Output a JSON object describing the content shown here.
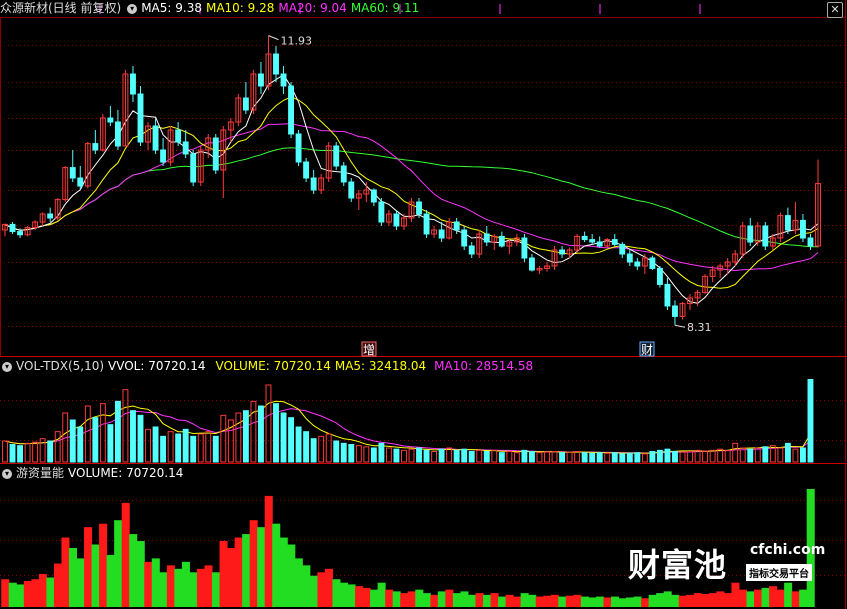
{
  "panel1": {
    "title": "众源新材(日线 前复权)",
    "ma5": "MA5: 9.38",
    "ma10": "MA10: 9.28",
    "ma20": "MA20: 9.04",
    "ma60": "MA60: 9.11",
    "high_label": "11.93",
    "low_label": "8.31",
    "marker1": "增",
    "marker2": "财"
  },
  "panel2": {
    "title": "VOL-TDX(5,10)",
    "vvol": "VVOL: 70720.14",
    "volume": "VOLUME: 70720.14",
    "ma5": "MA5: 32418.04",
    "ma10": "MA10: 28514.58"
  },
  "panel3": {
    "title": "游资量能",
    "volume": "VOLUME: 70720.14"
  },
  "watermark": {
    "main": "财富池",
    "site": "cfchi.com",
    "sub": "指标交易平台"
  },
  "close_icon": "close-icon",
  "colors": {
    "up": "#ff3b3b",
    "down": "#54ffff",
    "ma5": "#ffffff",
    "ma10": "#ffff00",
    "ma20": "#ff33ff",
    "ma60": "#33ff33",
    "red_fill": "#ff1a1a",
    "green_fill": "#22dd22",
    "grid": "#8a0000"
  },
  "chart_data": [
    {
      "type": "candlestick",
      "name": "price",
      "ohlc": [
        [
          9.5,
          9.58,
          9.42,
          9.57
        ],
        [
          9.57,
          9.6,
          9.45,
          9.48
        ],
        [
          9.48,
          9.52,
          9.4,
          9.44
        ],
        [
          9.44,
          9.55,
          9.42,
          9.53
        ],
        [
          9.53,
          9.62,
          9.5,
          9.6
        ],
        [
          9.6,
          9.72,
          9.55,
          9.7
        ],
        [
          9.7,
          9.78,
          9.6,
          9.65
        ],
        [
          9.65,
          9.9,
          9.62,
          9.88
        ],
        [
          9.88,
          10.3,
          9.85,
          10.28
        ],
        [
          10.28,
          10.5,
          10.1,
          10.15
        ],
        [
          10.15,
          10.3,
          10.0,
          10.05
        ],
        [
          10.05,
          10.6,
          10.02,
          10.58
        ],
        [
          10.58,
          10.75,
          10.45,
          10.5
        ],
        [
          10.5,
          10.95,
          10.48,
          10.9
        ],
        [
          10.9,
          11.05,
          10.8,
          10.85
        ],
        [
          10.85,
          11.0,
          10.5,
          10.55
        ],
        [
          10.55,
          11.5,
          10.55,
          11.45
        ],
        [
          11.45,
          11.55,
          11.1,
          11.2
        ],
        [
          11.2,
          11.3,
          10.55,
          10.6
        ],
        [
          10.6,
          10.85,
          10.5,
          10.8
        ],
        [
          10.8,
          10.9,
          10.45,
          10.5
        ],
        [
          10.5,
          10.65,
          10.3,
          10.35
        ],
        [
          10.35,
          10.8,
          10.3,
          10.75
        ],
        [
          10.75,
          10.85,
          10.55,
          10.6
        ],
        [
          10.6,
          10.75,
          10.4,
          10.45
        ],
        [
          10.45,
          10.5,
          10.05,
          10.1
        ],
        [
          10.1,
          10.55,
          10.05,
          10.5
        ],
        [
          10.5,
          10.7,
          10.4,
          10.65
        ],
        [
          10.65,
          10.7,
          10.2,
          10.25
        ],
        [
          10.25,
          10.8,
          9.9,
          10.75
        ],
        [
          10.75,
          10.9,
          10.6,
          10.85
        ],
        [
          10.85,
          11.2,
          10.8,
          11.15
        ],
        [
          11.15,
          11.35,
          10.95,
          11.0
        ],
        [
          11.0,
          11.5,
          10.95,
          11.45
        ],
        [
          11.45,
          11.6,
          11.2,
          11.3
        ],
        [
          11.3,
          11.93,
          11.25,
          11.7
        ],
        [
          11.7,
          11.8,
          11.35,
          11.45
        ],
        [
          11.45,
          11.55,
          11.2,
          11.3
        ],
        [
          11.3,
          11.35,
          10.65,
          10.7
        ],
        [
          10.7,
          10.75,
          10.3,
          10.35
        ],
        [
          10.35,
          10.4,
          10.1,
          10.15
        ],
        [
          10.15,
          10.25,
          9.95,
          10.0
        ],
        [
          10.0,
          10.2,
          9.95,
          10.15
        ],
        [
          10.15,
          10.6,
          10.1,
          10.55
        ],
        [
          10.55,
          10.6,
          10.25,
          10.3
        ],
        [
          10.3,
          10.35,
          10.05,
          10.1
        ],
        [
          10.1,
          10.15,
          9.85,
          9.9
        ],
        [
          9.9,
          10.0,
          9.75,
          9.95
        ],
        [
          9.95,
          10.1,
          9.85,
          10.0
        ],
        [
          10.0,
          10.02,
          9.8,
          9.85
        ],
        [
          9.85,
          9.9,
          9.55,
          9.6
        ],
        [
          9.6,
          9.75,
          9.55,
          9.7
        ],
        [
          9.7,
          9.75,
          9.5,
          9.55
        ],
        [
          9.55,
          9.7,
          9.5,
          9.65
        ],
        [
          9.65,
          9.9,
          9.6,
          9.85
        ],
        [
          9.85,
          9.9,
          9.65,
          9.7
        ],
        [
          9.7,
          9.75,
          9.4,
          9.45
        ],
        [
          9.45,
          9.55,
          9.4,
          9.5
        ],
        [
          9.5,
          9.6,
          9.35,
          9.4
        ],
        [
          9.4,
          9.65,
          9.38,
          9.6
        ],
        [
          9.6,
          9.65,
          9.45,
          9.5
        ],
        [
          9.5,
          9.55,
          9.25,
          9.3
        ],
        [
          9.3,
          9.35,
          9.15,
          9.2
        ],
        [
          9.2,
          9.5,
          9.15,
          9.45
        ],
        [
          9.45,
          9.55,
          9.3,
          9.35
        ],
        [
          9.35,
          9.45,
          9.25,
          9.42
        ],
        [
          9.42,
          9.48,
          9.28,
          9.3
        ],
        [
          9.3,
          9.38,
          9.2,
          9.35
        ],
        [
          9.35,
          9.45,
          9.3,
          9.4
        ],
        [
          9.4,
          9.45,
          9.1,
          9.15
        ],
        [
          9.15,
          9.2,
          8.98,
          9.0
        ],
        [
          9.0,
          9.05,
          8.95,
          9.02
        ],
        [
          9.02,
          9.1,
          8.98,
          9.05
        ],
        [
          9.05,
          9.3,
          9.0,
          9.25
        ],
        [
          9.25,
          9.3,
          9.15,
          9.2
        ],
        [
          9.2,
          9.28,
          9.15,
          9.25
        ],
        [
          9.25,
          9.45,
          9.22,
          9.42
        ],
        [
          9.42,
          9.48,
          9.35,
          9.38
        ],
        [
          9.38,
          9.45,
          9.32,
          9.35
        ],
        [
          9.35,
          9.42,
          9.28,
          9.3
        ],
        [
          9.3,
          9.4,
          9.28,
          9.38
        ],
        [
          9.38,
          9.45,
          9.3,
          9.32
        ],
        [
          9.32,
          9.35,
          9.15,
          9.2
        ],
        [
          9.2,
          9.25,
          9.05,
          9.1
        ],
        [
          9.1,
          9.15,
          9.0,
          9.05
        ],
        [
          9.05,
          9.2,
          8.95,
          9.15
        ],
        [
          9.15,
          9.18,
          9.0,
          9.02
        ],
        [
          9.02,
          9.05,
          8.78,
          8.82
        ],
        [
          8.82,
          8.9,
          8.5,
          8.55
        ],
        [
          8.55,
          8.62,
          8.31,
          8.42
        ],
        [
          8.42,
          8.6,
          8.38,
          8.58
        ],
        [
          8.58,
          8.7,
          8.5,
          8.65
        ],
        [
          8.65,
          8.75,
          8.55,
          8.72
        ],
        [
          8.72,
          8.95,
          8.7,
          8.92
        ],
        [
          8.92,
          9.05,
          8.85,
          9.0
        ],
        [
          9.0,
          9.08,
          8.9,
          9.05
        ],
        [
          9.05,
          9.15,
          8.95,
          9.1
        ],
        [
          9.1,
          9.25,
          9.05,
          9.2
        ],
        [
          9.2,
          9.6,
          9.15,
          9.55
        ],
        [
          9.55,
          9.65,
          9.3,
          9.35
        ],
        [
          9.35,
          9.6,
          9.3,
          9.55
        ],
        [
          9.55,
          9.6,
          9.25,
          9.3
        ],
        [
          9.3,
          9.45,
          9.25,
          9.4
        ],
        [
          9.4,
          9.72,
          9.35,
          9.68
        ],
        [
          9.68,
          9.78,
          9.45,
          9.5
        ],
        [
          9.5,
          9.85,
          9.45,
          9.62
        ],
        [
          9.62,
          9.7,
          9.35,
          9.4
        ],
        [
          9.4,
          9.45,
          9.25,
          9.3
        ],
        [
          9.3,
          10.38,
          9.28,
          10.08
        ]
      ]
    },
    {
      "type": "bar",
      "name": "VOLUME",
      "ymax": 72000,
      "values": [
        18000,
        15000,
        14000,
        16000,
        17000,
        20000,
        18000,
        26000,
        42000,
        36000,
        30000,
        48000,
        38000,
        50000,
        32000,
        52000,
        62000,
        44000,
        40000,
        28000,
        30000,
        22000,
        26000,
        24000,
        28000,
        22000,
        24000,
        26000,
        22000,
        40000,
        36000,
        42000,
        44000,
        52000,
        48000,
        66000,
        50000,
        42000,
        38000,
        30000,
        26000,
        20000,
        22000,
        24000,
        18000,
        16000,
        15000,
        14000,
        13000,
        12000,
        16000,
        12000,
        11000,
        10000,
        11000,
        12000,
        10000,
        9000,
        11000,
        12000,
        10000,
        11000,
        9000,
        10000,
        9000,
        10000,
        8000,
        9000,
        8000,
        10000,
        9000,
        8000,
        8500,
        9000,
        8000,
        8500,
        9000,
        8000,
        7500,
        8000,
        7500,
        8000,
        7000,
        7500,
        8000,
        7000,
        9000,
        10000,
        11000,
        9000,
        8500,
        9000,
        10000,
        9500,
        10000,
        11000,
        10000,
        16000,
        12000,
        11000,
        12000,
        13000,
        14000,
        12000,
        16000,
        11000,
        12000,
        70720
      ]
    },
    {
      "type": "bar",
      "name": "游资量能",
      "ymax": 72000,
      "values": [
        16000,
        14000,
        13000,
        15000,
        16000,
        19000,
        17000,
        25000,
        40000,
        34000,
        28000,
        46000,
        36000,
        48000,
        30000,
        50000,
        60000,
        42000,
        38000,
        26000,
        28000,
        20000,
        24000,
        22000,
        26000,
        20000,
        22000,
        24000,
        20000,
        38000,
        34000,
        40000,
        42000,
        50000,
        46000,
        64000,
        48000,
        40000,
        36000,
        28000,
        24000,
        18000,
        20000,
        22000,
        16000,
        14000,
        13000,
        12000,
        11000,
        10000,
        14000,
        10000,
        9000,
        8000,
        9000,
        10000,
        8000,
        7000,
        9000,
        10000,
        8000,
        9000,
        7000,
        8000,
        7000,
        8000,
        6000,
        7000,
        6000,
        8000,
        7000,
        6000,
        6500,
        7000,
        6000,
        6500,
        7000,
        6000,
        5500,
        6000,
        5500,
        6000,
        5000,
        5500,
        6000,
        5000,
        7000,
        8000,
        9000,
        7000,
        6500,
        7000,
        8000,
        7500,
        8000,
        9000,
        8000,
        14000,
        10000,
        9000,
        10000,
        11000,
        12000,
        10000,
        14000,
        9000,
        10000,
        68000
      ]
    }
  ]
}
